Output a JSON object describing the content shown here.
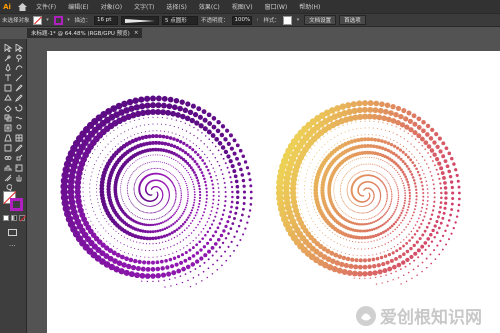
{
  "app": {
    "logo": "Ai"
  },
  "menu": [
    "文件(F)",
    "编辑(E)",
    "对象(O)",
    "文字(T)",
    "选择(S)",
    "效果(C)",
    "视图(V)",
    "窗口(W)",
    "帮助(H)"
  ],
  "control": {
    "selection_label": "未选择对象",
    "stroke_label": "描边：",
    "stroke_weight": "16 pt",
    "brush_label": "5 点圆形",
    "opacity_label": "不透明度：",
    "opacity_value": "100%",
    "style_label": "样式：",
    "doc_setup_button": "文档设置",
    "prefs_button": "首选项"
  },
  "document": {
    "tab_title": "未标题-1* @ 64.48% (RGB/GPU 预览)",
    "close_glyph": "×"
  },
  "watermark": {
    "text": "爱创根知识网"
  },
  "colors": {
    "purple_dark": "#5a0b82",
    "purple_mid": "#9a1ab8",
    "magenta": "#cc1f6e",
    "yellow": "#f2ea52"
  },
  "icons": [
    "selection-icon",
    "direct-selection-icon",
    "magic-wand-icon",
    "lasso-icon",
    "pen-icon",
    "curvature-icon",
    "type-icon",
    "line-icon",
    "rectangle-icon",
    "paintbrush-icon",
    "shaper-icon",
    "pencil-icon",
    "eraser-icon",
    "rotate-icon",
    "scale-icon",
    "width-icon",
    "free-transform-icon",
    "shape-builder-icon",
    "perspective-icon",
    "mesh-icon",
    "gradient-icon",
    "eyedropper-icon",
    "blend-icon",
    "symbol-sprayer-icon",
    "graph-icon",
    "artboard-icon",
    "slice-icon",
    "hand-icon",
    "zoom-icon"
  ]
}
